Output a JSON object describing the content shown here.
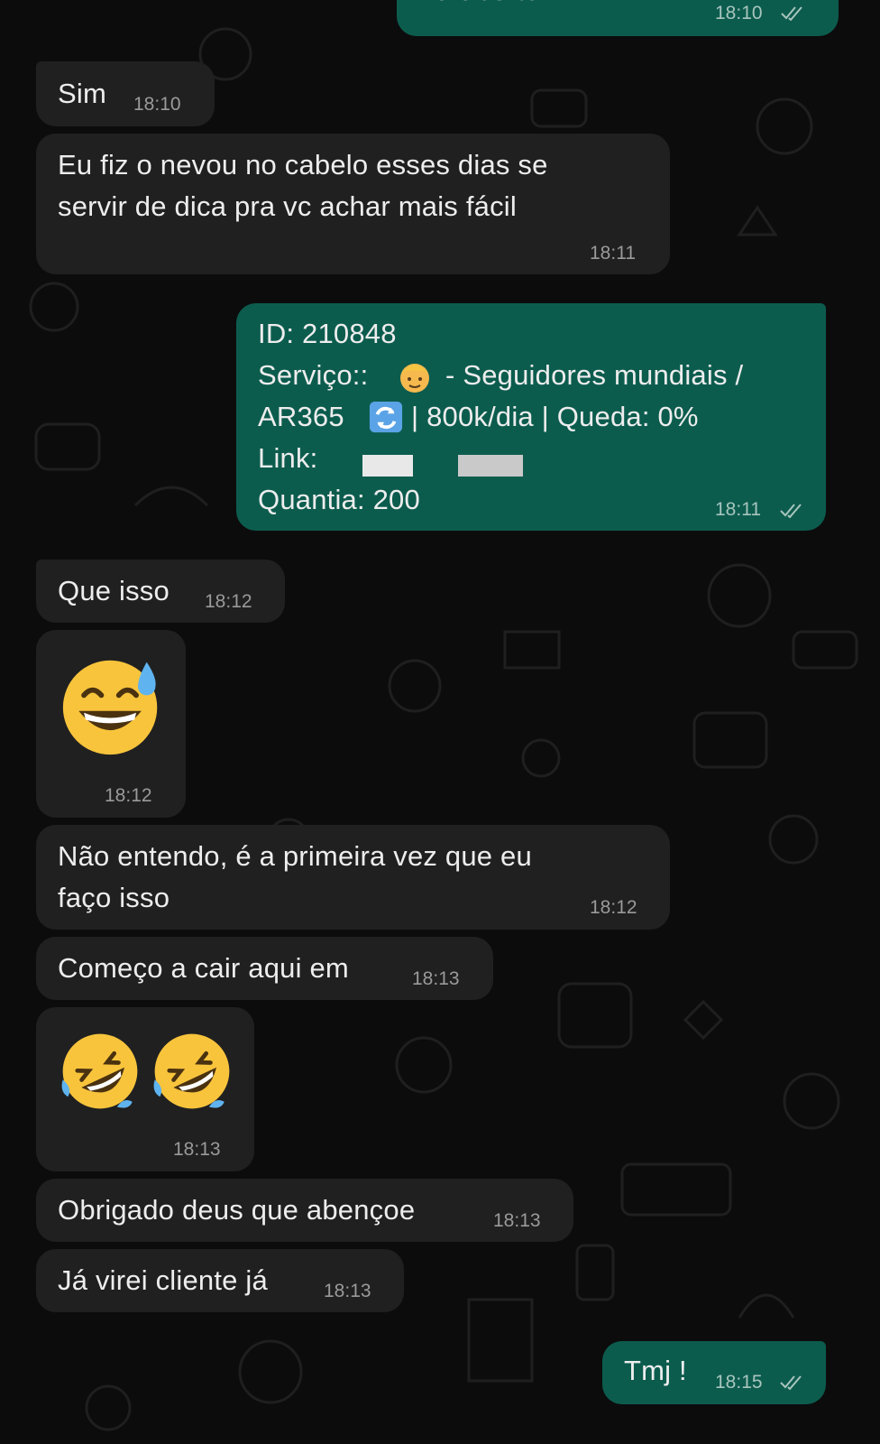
{
  "messages": [
    {
      "id": "m0",
      "direction": "out",
      "text": "Ta aberto ?",
      "time": "18:10"
    },
    {
      "id": "m1",
      "direction": "in",
      "text": "Sim",
      "time": "18:10"
    },
    {
      "id": "m2",
      "direction": "in",
      "lines": [
        "Eu fiz o nevou no cabelo esses dias se",
        "servir de dica pra vc achar mais fácil"
      ],
      "time": "18:11"
    },
    {
      "id": "m3",
      "direction": "out",
      "id_line": "ID: 210848",
      "service_prefix": "Serviço::",
      "service_suffix": "- Seguidores mundiais /",
      "service_line2_a": "AR365",
      "service_line2_b": "| 800k/dia | Queda: 0%",
      "link_label": "Link:",
      "quantity": "Quantia: 200",
      "time": "18:11"
    },
    {
      "id": "m4",
      "direction": "in",
      "text": "Que isso",
      "time": "18:12"
    },
    {
      "id": "m5",
      "direction": "in",
      "emoji": "grinning-face-with-sweat",
      "time": "18:12"
    },
    {
      "id": "m6",
      "direction": "in",
      "lines": [
        "Não entendo, é a primeira vez que eu",
        "faço isso"
      ],
      "time": "18:12"
    },
    {
      "id": "m7",
      "direction": "in",
      "text": "Começo a cair aqui em",
      "time": "18:13"
    },
    {
      "id": "m8",
      "direction": "in",
      "emoji": "rolling-on-the-floor-laughing x2",
      "time": "18:13"
    },
    {
      "id": "m9",
      "direction": "in",
      "text": "Obrigado deus que abençoe",
      "time": "18:13"
    },
    {
      "id": "m10",
      "direction": "in",
      "text": "Já virei cliente já",
      "time": "18:13"
    },
    {
      "id": "m11",
      "direction": "out",
      "text": "Tmj !",
      "time": "18:15"
    }
  ],
  "colors": {
    "background": "#0c0c0c",
    "incoming_bubble": "#202020",
    "outgoing_bubble": "#0c5c4e",
    "text": "#ededed",
    "timestamp_in": "#9a9a9a",
    "timestamp_out": "#a7c5bd"
  },
  "icons": [
    "double-check-icon",
    "person-emoji-icon",
    "repeat-button-icon",
    "grinning-sweat-emoji",
    "rofl-emoji"
  ]
}
